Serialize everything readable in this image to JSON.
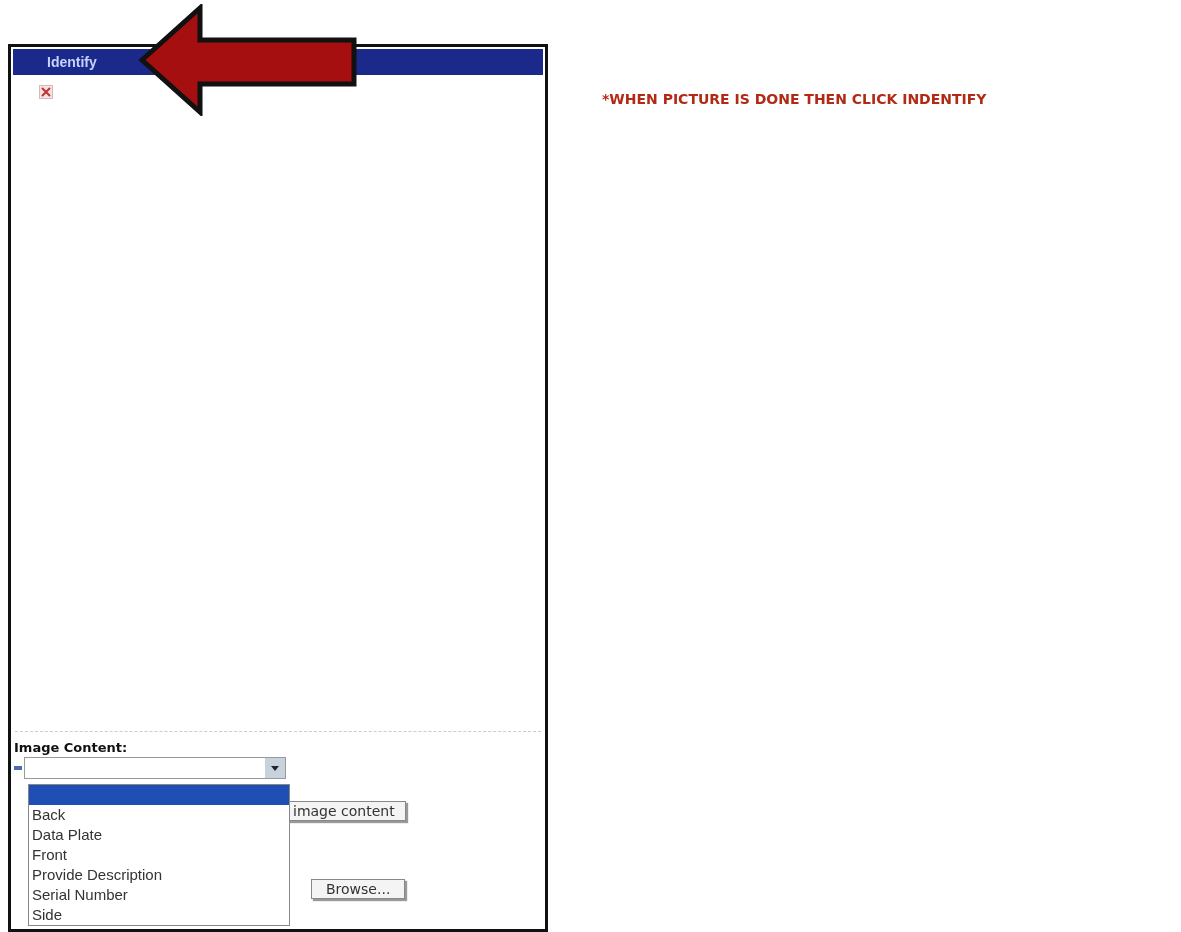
{
  "dialog": {
    "title": "Identify",
    "image_content": {
      "label": "Image Content:",
      "blank_option_selected": true,
      "options": [
        {
          "label": "Back",
          "selected": false
        },
        {
          "label": "Data Plate",
          "selected": false
        },
        {
          "label": "Front",
          "selected": false
        },
        {
          "label": "Provide Description",
          "selected": false
        },
        {
          "label": "Serial Number",
          "selected": false
        },
        {
          "label": "Side",
          "selected": false
        }
      ]
    },
    "buttons": [
      {
        "kind": "partial",
        "label": "image content"
      },
      {
        "kind": "browse",
        "label": "Browse..."
      }
    ]
  },
  "annotation": {
    "note": "*WHEN PICTURE IS DONE THEN CLICK INDENTIFY"
  }
}
